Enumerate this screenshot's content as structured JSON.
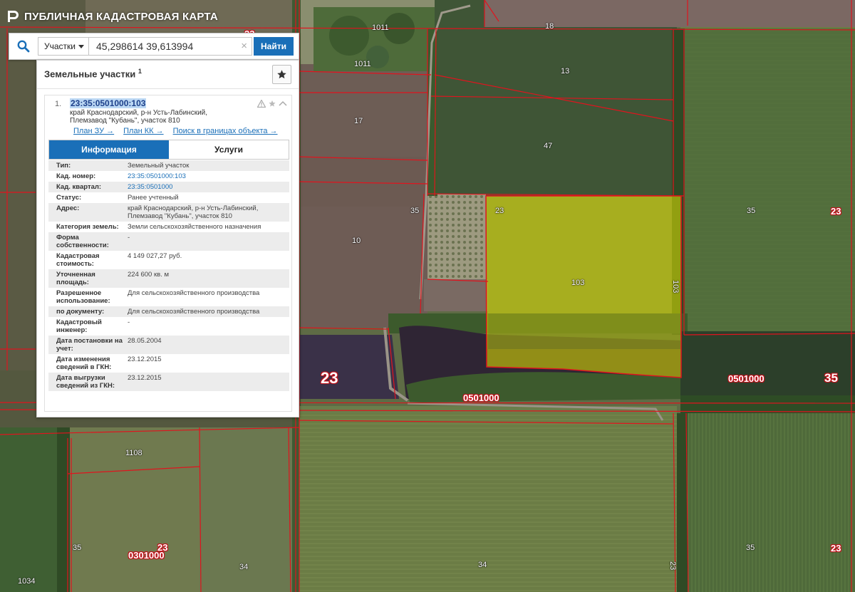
{
  "app": {
    "title": "ПУБЛИЧНАЯ КАДАСТРОВАЯ КАРТА"
  },
  "search": {
    "type_label": "Участки",
    "query": "45,298614 39,613994",
    "clear_label": "×",
    "submit_label": "Найти"
  },
  "panel": {
    "title": "Земельные участки",
    "count": "1",
    "result": {
      "index": "1.",
      "cad_number": "23:35:0501000:103",
      "address_line1": "край Краснодарский, р-н Усть-Лабинский,",
      "address_line2": "Племзавод \"Кубань\", участок 810",
      "links": [
        "План ЗУ →",
        "План КК →",
        "Поиск в границах объекта →"
      ],
      "tabs": {
        "info": "Информация",
        "services": "Услуги"
      },
      "fields": [
        {
          "key": "Тип:",
          "value": "Земельный участок"
        },
        {
          "key": "Кад. номер:",
          "value": "23:35:0501000:103"
        },
        {
          "key": "Кад. квартал:",
          "value": "23:35:0501000"
        },
        {
          "key": "Статус:",
          "value": "Ранее учтенный"
        },
        {
          "key": "Адрес:",
          "value": "край Краснодарский, р-н Усть-Лабинский, Племзавод \"Кубань\", участок 810"
        },
        {
          "key": "Категория земель:",
          "value": "Земли сельскохозяйственного назначения"
        },
        {
          "key": "Форма собственности:",
          "value": "-"
        },
        {
          "key": "Кадастровая стоимость:",
          "value": "4 149 027,27 руб."
        },
        {
          "key": "Уточненная площадь:",
          "value": "224 600 кв. м"
        },
        {
          "key": "Разрешенное использование:",
          "value": "Для сельскохозяйственного производства"
        },
        {
          "key": "по документу:",
          "value": "Для сельскохозяйственного производства"
        },
        {
          "key": "Кадастровый инженер:",
          "value": "-"
        },
        {
          "key": "Дата постановки на учет:",
          "value": "28.05.2004"
        },
        {
          "key": "Дата изменения сведений в ГКН:",
          "value": "23.12.2015"
        },
        {
          "key": "Дата выгрузки сведений из ГКН:",
          "value": "23.12.2015"
        }
      ]
    }
  },
  "map": {
    "labels": {
      "l1011a": "1011",
      "l1011b": "1011",
      "l18": "18",
      "l13": "13",
      "l17": "17",
      "l47": "47",
      "l23a": "23",
      "l35a": "35",
      "l23c": "23",
      "l10": "10",
      "l103a": "103",
      "l103b": "103",
      "l23big": "23",
      "l0501000a": "0501000",
      "l35b": "35",
      "l0501000b": "0501000",
      "l1108": "1108",
      "l35c": "35",
      "l23d": "23",
      "l0301000": "0301000",
      "l1034": "1034",
      "l34a": "34",
      "l34b": "34",
      "l35d": "35",
      "l23e": "23",
      "l23f": "23",
      "l35e": "35",
      "l23b": "23"
    },
    "colors": {
      "boundary": "#e0141e",
      "highlight": "#e4e600",
      "panel_accent": "#1a6fb8"
    }
  }
}
